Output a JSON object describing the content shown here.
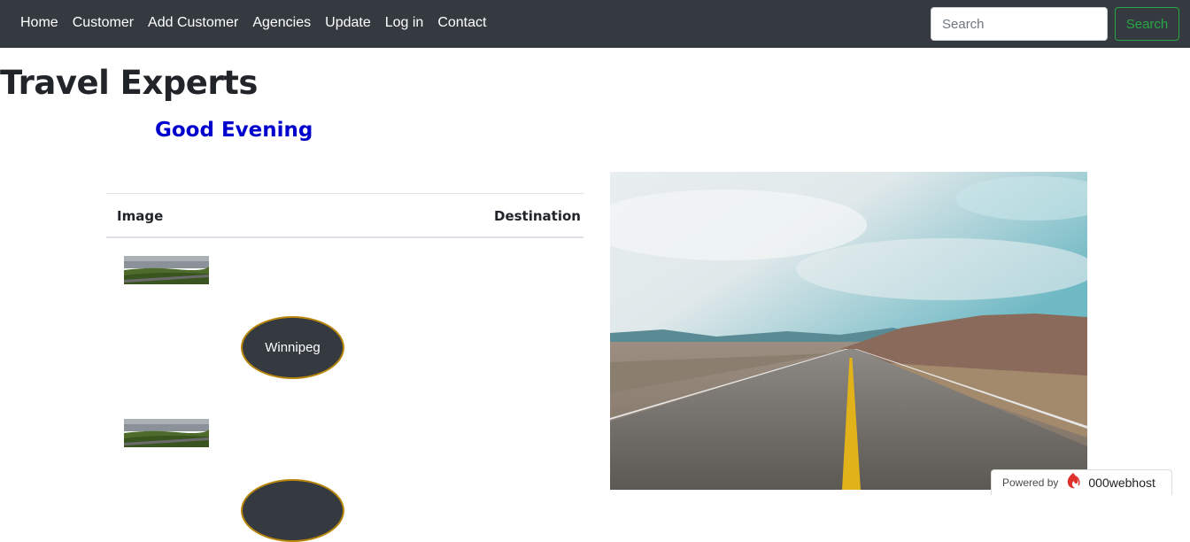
{
  "nav": {
    "links": [
      "Home",
      "Customer",
      "Add Customer",
      "Agencies",
      "Update",
      "Log in",
      "Contact"
    ],
    "search_placeholder": "Search",
    "search_button": "Search"
  },
  "page": {
    "title": "Travel Experts",
    "greeting": "Good Evening"
  },
  "table": {
    "headers": {
      "image": "Image",
      "destination": "Destination"
    },
    "rows": [
      {
        "destination": "Winnipeg"
      },
      {
        "destination": ""
      }
    ]
  },
  "badge": {
    "prefix": "Powered by",
    "brand": "000webhost",
    "icon": "flame-logo-icon"
  },
  "colors": {
    "navbar": "#343a40",
    "greeting": "#0000cd",
    "search_button": "#28a745",
    "destination_border": "#b8860b"
  }
}
